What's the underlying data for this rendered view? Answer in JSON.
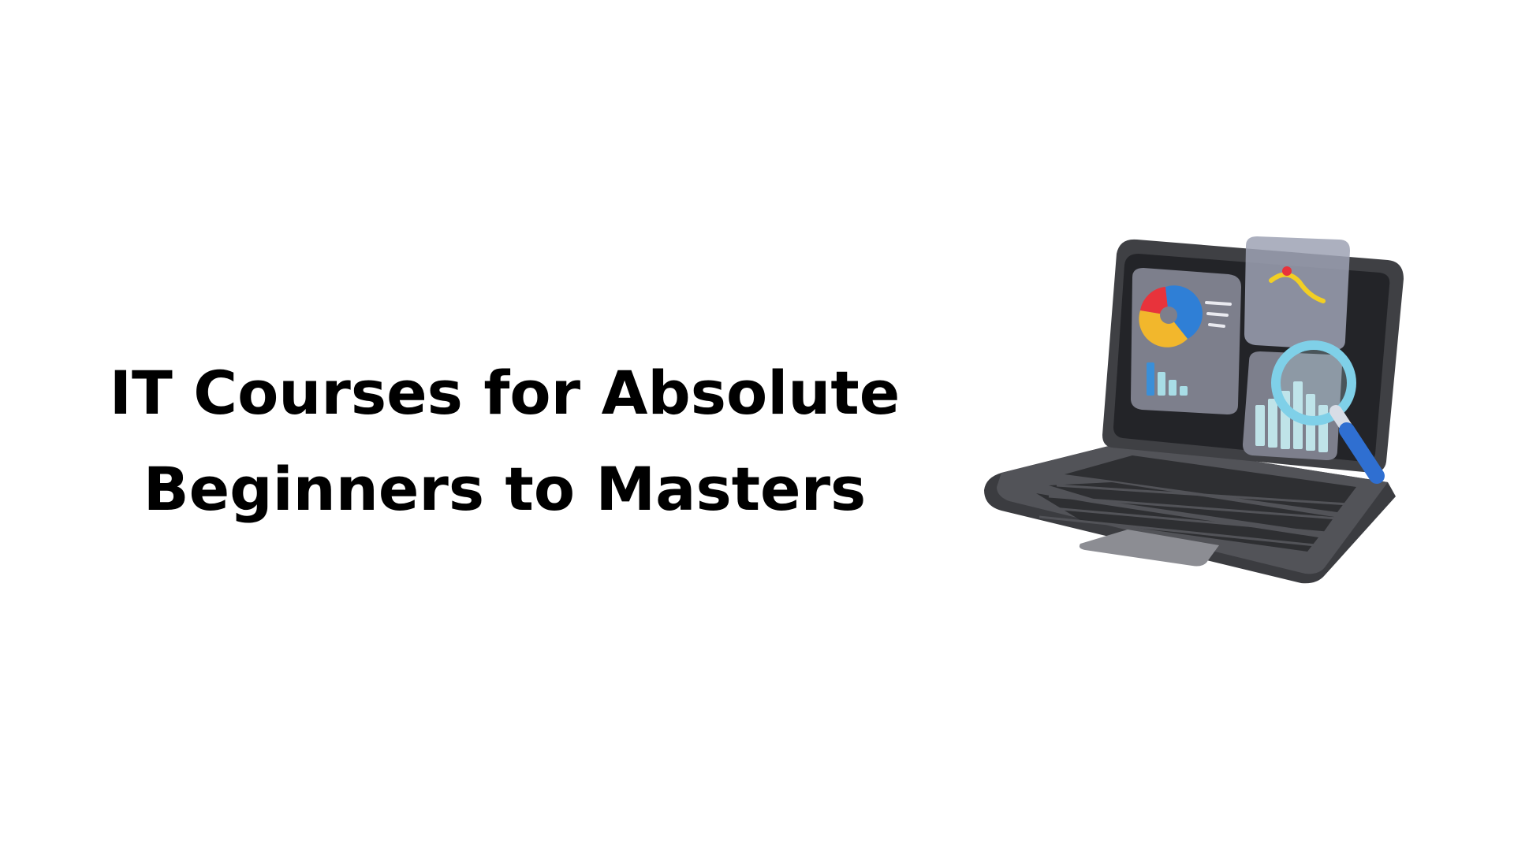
{
  "headline": {
    "line1": "IT Courses for Absolute",
    "line2": "Beginners to Masters"
  },
  "illustration": {
    "icon": "laptop-analytics-icon",
    "colors": {
      "background": "#ffffff",
      "text": "#000000",
      "laptop_body": "#3f4044",
      "screen": "#2b2c30",
      "panel": "#7d7f8c",
      "pie_red": "#e8333b",
      "pie_blue": "#2f7fd6",
      "pie_yellow": "#f2b72c",
      "bars": "#a8dde6",
      "magnifier_ring": "#7fd0e8",
      "magnifier_handle": "#2f6fd1",
      "curve": "#f2cf24"
    }
  }
}
